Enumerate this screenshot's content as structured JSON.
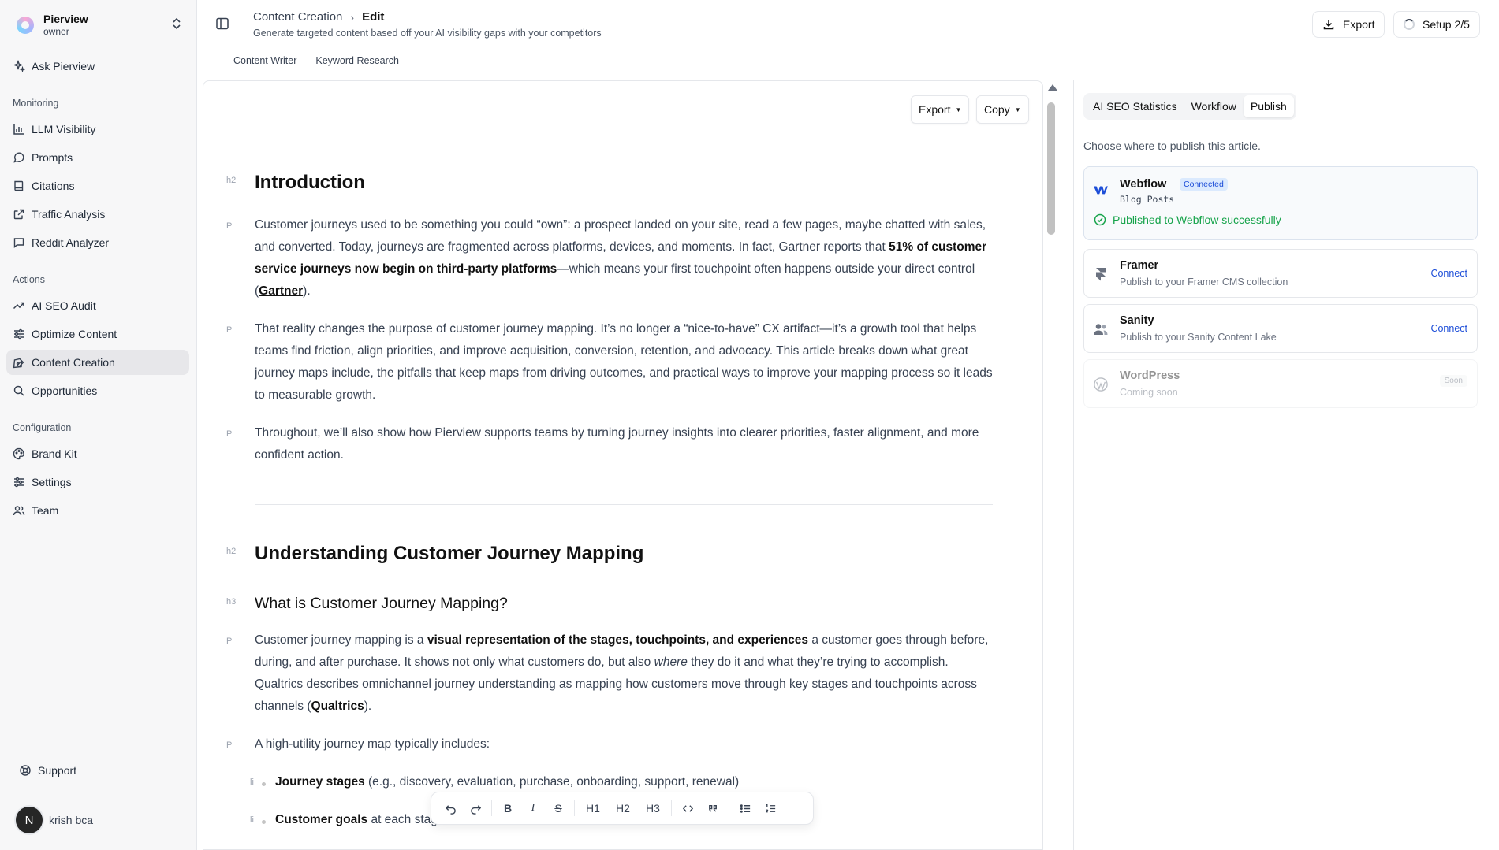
{
  "workspace": {
    "name": "Pierview",
    "role": "owner"
  },
  "sidebar": {
    "ask": "Ask Pierview",
    "monitoring_label": "Monitoring",
    "monitoring": [
      "LLM Visibility",
      "Prompts",
      "Citations",
      "Traffic Analysis",
      "Reddit Analyzer"
    ],
    "actions_label": "Actions",
    "actions": [
      "AI SEO Audit",
      "Optimize Content",
      "Content Creation",
      "Opportunities"
    ],
    "config_label": "Configuration",
    "config": [
      "Brand Kit",
      "Settings",
      "Team"
    ],
    "support": "Support",
    "user": {
      "initial": "N",
      "name": "krish bca"
    }
  },
  "header": {
    "breadcrumb_parent": "Content Creation",
    "breadcrumb_sep": "›",
    "breadcrumb_current": "Edit",
    "subtitle": "Generate targeted content based off your AI visibility gaps with your competitors",
    "tabs": [
      "Content Writer",
      "Keyword Research"
    ],
    "export": "Export",
    "setup": "Setup 2/5"
  },
  "editor": {
    "export": "Export",
    "copy": "Copy",
    "caret": "▼",
    "tags": {
      "h2": "h2",
      "h3": "h3",
      "p": "P",
      "li": "li"
    },
    "h_intro": "Introduction",
    "p1": {
      "a": "Customer journeys used to be something you could “own”: a prospect landed on your site, read a few pages, maybe chatted with sales, and converted. Today, journeys are fragmented across platforms, devices, and moments. In fact, Gartner reports that ",
      "b": "51% of customer service journeys now begin on third-party platforms",
      "c": "—which means your first touchpoint often happens outside your direct control (",
      "link": "Gartner",
      "d": ")."
    },
    "p2": "That reality changes the purpose of customer journey mapping. It’s no longer a “nice-to-have” CX artifact—it’s a growth tool that helps teams find friction, align priorities, and improve acquisition, conversion, retention, and advocacy. This article breaks down what great journey maps include, the pitfalls that keep maps from driving outcomes, and practical ways to improve your mapping process so it leads to measurable growth.",
    "p3": "Throughout, we’ll also show how Pierview supports teams by turning journey insights into clearer priorities, faster alignment, and more confident action.",
    "h_understanding": "Understanding Customer Journey Mapping",
    "h_what": "What is Customer Journey Mapping?",
    "p4": {
      "a": "Customer journey mapping is a ",
      "b": "visual representation of the stages, touchpoints, and experiences",
      "c": " a customer goes through before, during, and after purchase. It shows not only what customers do, but also ",
      "em": "where",
      "d": " they do it and what they’re trying to accomplish. Qualtrics describes omnichannel journey understanding as mapping how customers move through key stages and touchpoints across channels (",
      "link": "Qualtrics",
      "e": ")."
    },
    "p5": "A high-utility journey map typically includes:",
    "li1": {
      "b": "Journey stages",
      "rest": " (e.g., discovery, evaluation, purchase, onboarding, support, renewal)"
    },
    "li2": {
      "b": "Customer goals",
      "rest": " at each stag"
    }
  },
  "format_bar": {
    "bold": "B",
    "italic": "I",
    "strike": "S",
    "h1": "H1",
    "h2": "H2",
    "h3": "H3"
  },
  "panel": {
    "tabs": [
      "AI SEO Statistics",
      "Workflow",
      "Publish"
    ],
    "intro": "Choose where to publish this article.",
    "webflow": {
      "name": "Webflow",
      "badge": "Connected",
      "collection": "Blog Posts",
      "status": "Published to Webflow successfully"
    },
    "framer": {
      "name": "Framer",
      "desc": "Publish to your Framer CMS collection",
      "action": "Connect"
    },
    "sanity": {
      "name": "Sanity",
      "desc": "Publish to your Sanity Content Lake",
      "action": "Connect"
    },
    "wordpress": {
      "name": "WordPress",
      "desc": "Coming soon",
      "badge": "Soon"
    }
  },
  "colors": {
    "accent": "#1d4ed8",
    "success": "#16a34a",
    "active_nav": "#e7e7ea"
  }
}
